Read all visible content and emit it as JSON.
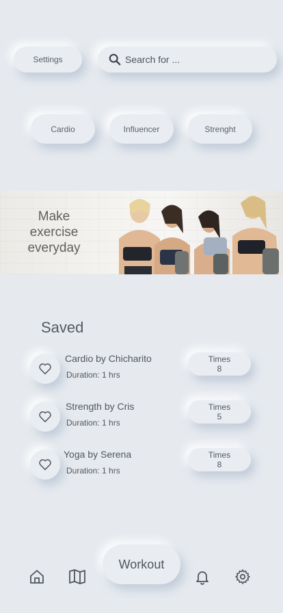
{
  "header": {
    "settings_label": "Settings",
    "search_placeholder": "Search for ..."
  },
  "categories": [
    "Cardio",
    "Influencer",
    "Strenght"
  ],
  "banner": {
    "lines": [
      "Make",
      "exercise",
      "everyday"
    ]
  },
  "saved": {
    "title": "Saved",
    "items": [
      {
        "title": "Cardio by Chicharito",
        "duration": "Duration: 1 hrs",
        "times_label": "Times",
        "times_value": "8"
      },
      {
        "title": "Strength by Cris",
        "duration": "Duration: 1 hrs",
        "times_label": "Times",
        "times_value": "5"
      },
      {
        "title": "Yoga by Serena",
        "duration": "Duration: 1 hrs",
        "times_label": "Times",
        "times_value": "8"
      }
    ]
  },
  "bottom_nav": {
    "workout_label": "Workout",
    "icons": [
      "home-icon",
      "map-icon",
      "bell-icon",
      "gear-icon"
    ]
  },
  "colors": {
    "background": "#e6eaef",
    "surface": "#e9edf2",
    "text": "#555b63"
  }
}
